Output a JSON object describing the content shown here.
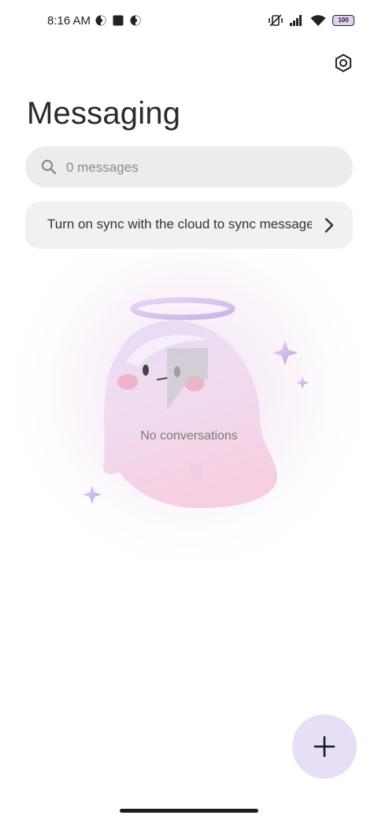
{
  "status_bar": {
    "time": "8:16 AM",
    "battery": "100"
  },
  "header": {
    "title": "Messaging",
    "settings_icon": "gear-icon"
  },
  "search": {
    "placeholder": "0 messages",
    "icon": "search-icon"
  },
  "sync_banner": {
    "text": "Turn on sync with the cloud to sync messages",
    "icon": "chevron-right-icon"
  },
  "empty_state": {
    "text": "No conversations",
    "illustration": "ghost-with-halo"
  },
  "fab": {
    "icon": "plus-icon"
  },
  "colors": {
    "fab_background": "#e7dff6",
    "search_background": "#ececec",
    "card_background": "#f1f1f1"
  }
}
